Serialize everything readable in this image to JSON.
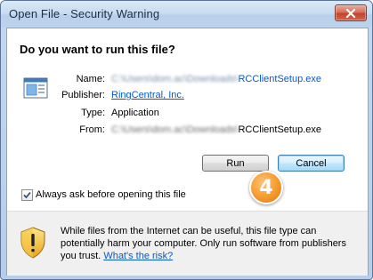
{
  "window": {
    "title": "Open File - Security Warning",
    "close_icon": "close-x-icon"
  },
  "heading": "Do you want to run this file?",
  "file_icon": "application-window-icon",
  "fields": {
    "name": {
      "label": "Name:",
      "value_obscured": "C:\\Users\\dom.ac\\Downloads\\",
      "value_visible": "RCClientSetup.exe"
    },
    "publisher": {
      "label": "Publisher:",
      "value": "RingCentral, Inc."
    },
    "type": {
      "label": "Type:",
      "value": "Application"
    },
    "from": {
      "label": "From:",
      "value_obscured": "C:\\Users\\dom.ac\\Downloads\\",
      "value_visible": "RCClientSetup.exe"
    }
  },
  "buttons": {
    "run": "Run",
    "cancel": "Cancel"
  },
  "step_badge": "4",
  "checkbox": {
    "label": "Always ask before opening this file",
    "checked": true
  },
  "warning": {
    "icon": "security-shield-icon",
    "text": "While files from the Internet can be useful, this file type can potentially harm your computer. Only run software from publishers you trust.",
    "link": "What's the risk?"
  },
  "colors": {
    "link": "#0b59c6",
    "badge": "#f59a2a",
    "title_bar": "#c9dcf1"
  }
}
